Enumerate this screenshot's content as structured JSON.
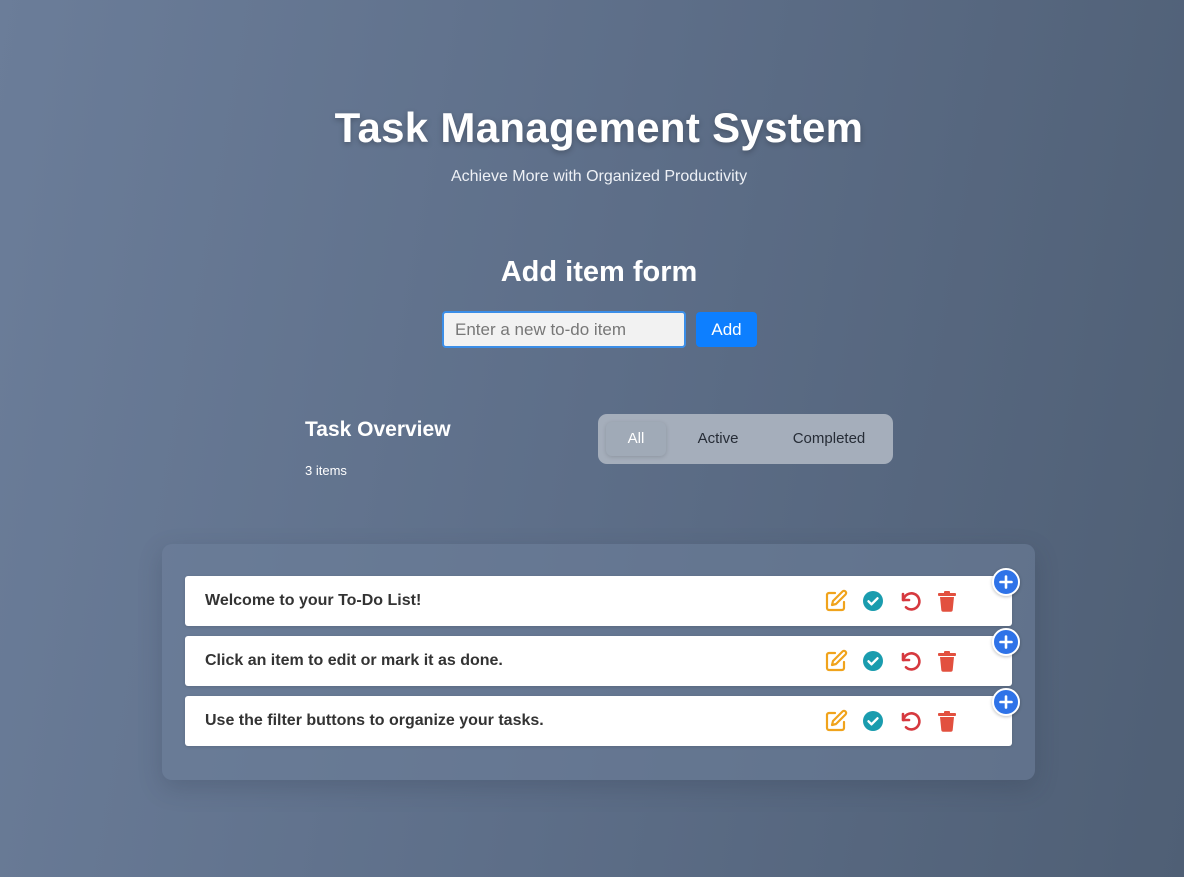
{
  "header": {
    "title": "Task Management System",
    "subtitle": "Achieve More with Organized Productivity"
  },
  "form": {
    "title": "Add item form",
    "input_placeholder": "Enter a new to-do item",
    "input_value": "",
    "add_label": "Add"
  },
  "overview": {
    "title": "Task Overview",
    "count_text": "3 items"
  },
  "filters": {
    "items": [
      {
        "label": "All",
        "active": true
      },
      {
        "label": "Active",
        "active": false
      },
      {
        "label": "Completed",
        "active": false
      }
    ]
  },
  "todos": [
    {
      "text": "Welcome to your To-Do List!",
      "actions": [
        "edit-icon",
        "check-icon",
        "undo-icon",
        "trash-icon"
      ]
    },
    {
      "text": "Click an item to edit or mark it as done.",
      "actions": [
        "edit-icon",
        "check-icon",
        "undo-icon",
        "trash-icon"
      ]
    },
    {
      "text": "Use the filter buttons to organize your tasks.",
      "actions": [
        "edit-icon",
        "check-icon",
        "undo-icon",
        "trash-icon"
      ]
    }
  ],
  "colors": {
    "accent": "#0d7fff",
    "edit": "#f0a31c",
    "check": "#1a9cae",
    "undo": "#d6393f",
    "delete": "#e2503f",
    "plus_badge": "#2f73e8"
  }
}
